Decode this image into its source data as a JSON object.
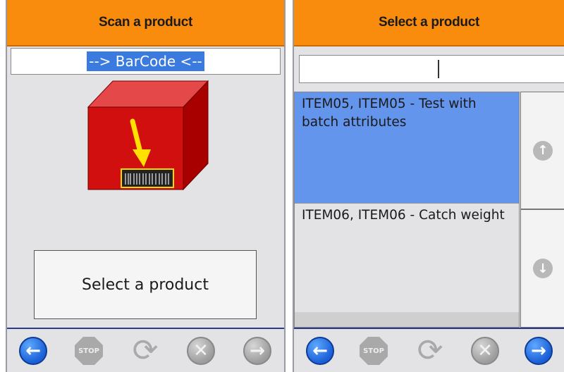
{
  "left_screen": {
    "title": "Scan a product",
    "barcode_field_value": "--> BarCode <--",
    "main_button_label": "Select a product"
  },
  "right_screen": {
    "title": "Select a product",
    "search_value": "",
    "items": [
      {
        "label": "ITEM05, ITEM05 - Test with batch attributes",
        "selected": true
      },
      {
        "label": "ITEM06, ITEM06 - Catch weight",
        "selected": false
      }
    ]
  },
  "toolbar": {
    "back_glyph": "←",
    "stop_label": "STOP",
    "refresh_glyph": "⟳",
    "cancel_glyph": "✕",
    "forward_glyph": "→",
    "scroll_up_glyph": "↑",
    "scroll_down_glyph": "↓"
  },
  "colors": {
    "title_bar": "#f98c0c",
    "selection": "#6495ed",
    "barcode_highlight": "#3b7be0",
    "nav_blue": "#1a5fd6"
  }
}
